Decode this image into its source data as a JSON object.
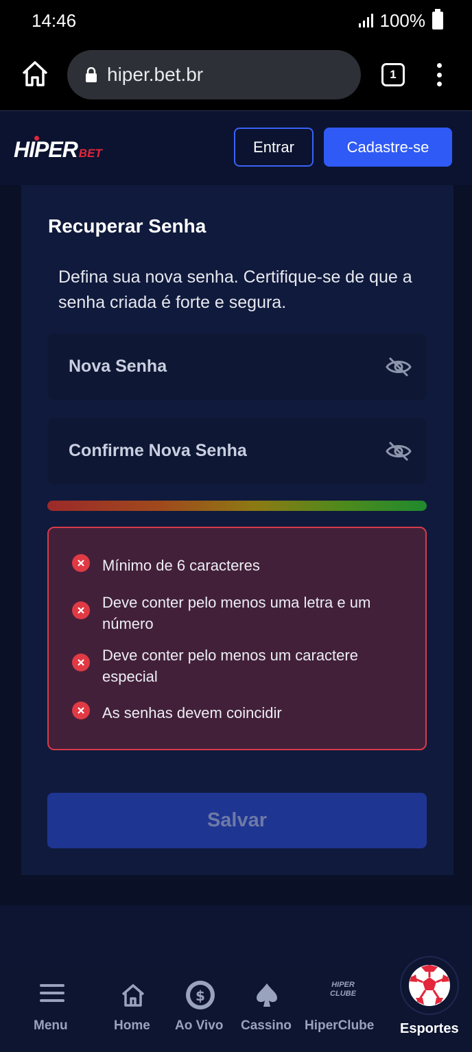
{
  "status_bar": {
    "time": "14:46",
    "battery": "100%"
  },
  "browser": {
    "url": "hiper.bet.br",
    "tab_count": "1"
  },
  "header": {
    "logo_main": "HIPER",
    "logo_sub": "BET",
    "login_label": "Entrar",
    "signup_label": "Cadastre-se"
  },
  "card": {
    "title": "Recuperar Senha",
    "description": "Defina sua nova senha. Certifique-se de que a senha criada é forte e segura.",
    "new_password_placeholder": "Nova Senha",
    "confirm_password_placeholder": "Confirme Nova Senha",
    "rules": [
      "Mínimo de 6 caracteres",
      "Deve conter pelo menos uma letra e um número",
      "Deve conter pelo menos um caractere especial",
      "As senhas devem coincidir"
    ],
    "save_label": "Salvar"
  },
  "bottom_nav": {
    "items": [
      {
        "label": "Menu",
        "icon": "hamburger-icon"
      },
      {
        "label": "Home",
        "icon": "home-icon"
      },
      {
        "label": "Ao Vivo",
        "icon": "live-coin-icon"
      },
      {
        "label": "Cassino",
        "icon": "spade-icon"
      },
      {
        "label": "HiperClube",
        "icon": "hiperclube-icon"
      },
      {
        "label": "Esportes",
        "icon": "soccer-ball-icon"
      }
    ],
    "hiperclube_badge": [
      "HIPER",
      "CLUBE"
    ]
  },
  "colors": {
    "primary": "#2f5af5",
    "error": "#e03a44",
    "background": "#0a1026"
  }
}
